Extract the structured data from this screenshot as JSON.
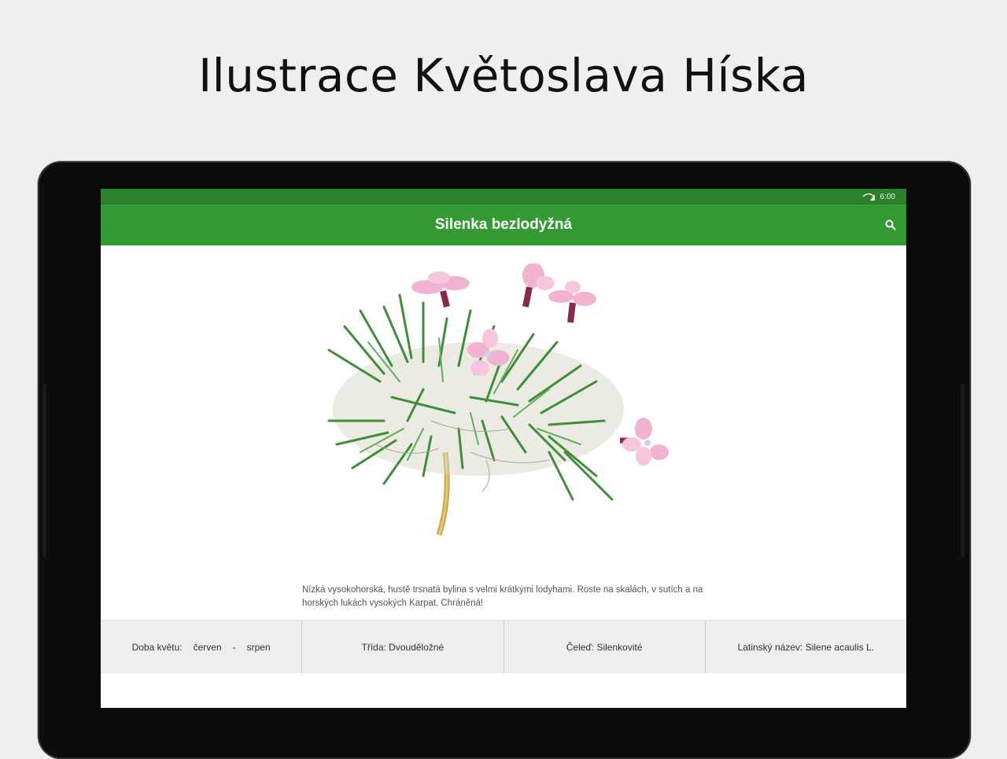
{
  "headline": "Ilustrace Květoslava Híska",
  "status": {
    "time": "6:00"
  },
  "appbar": {
    "title": "Silenka bezlodyžná",
    "search_icon": "search-icon"
  },
  "description": "Nízká vysokohorská, hustě trsnatá bylina s velmi krátkými lodyhami. Roste na skalách, v sutích a na horských lukách vysokých Karpat. Chráněná!",
  "info": {
    "bloom_label": "Doba květu:",
    "bloom_from": "červen",
    "bloom_sep": "-",
    "bloom_to": "srpen",
    "class": "Třída: Dvouděložné",
    "family": "Čeleď: Silenkovité",
    "latin": "Latinský název: Silene acaulis L."
  },
  "colors": {
    "status": "#2c7f2c",
    "appbar": "#349b34",
    "petal": "#f2b3d0",
    "leaf": "#3f8f3a"
  }
}
